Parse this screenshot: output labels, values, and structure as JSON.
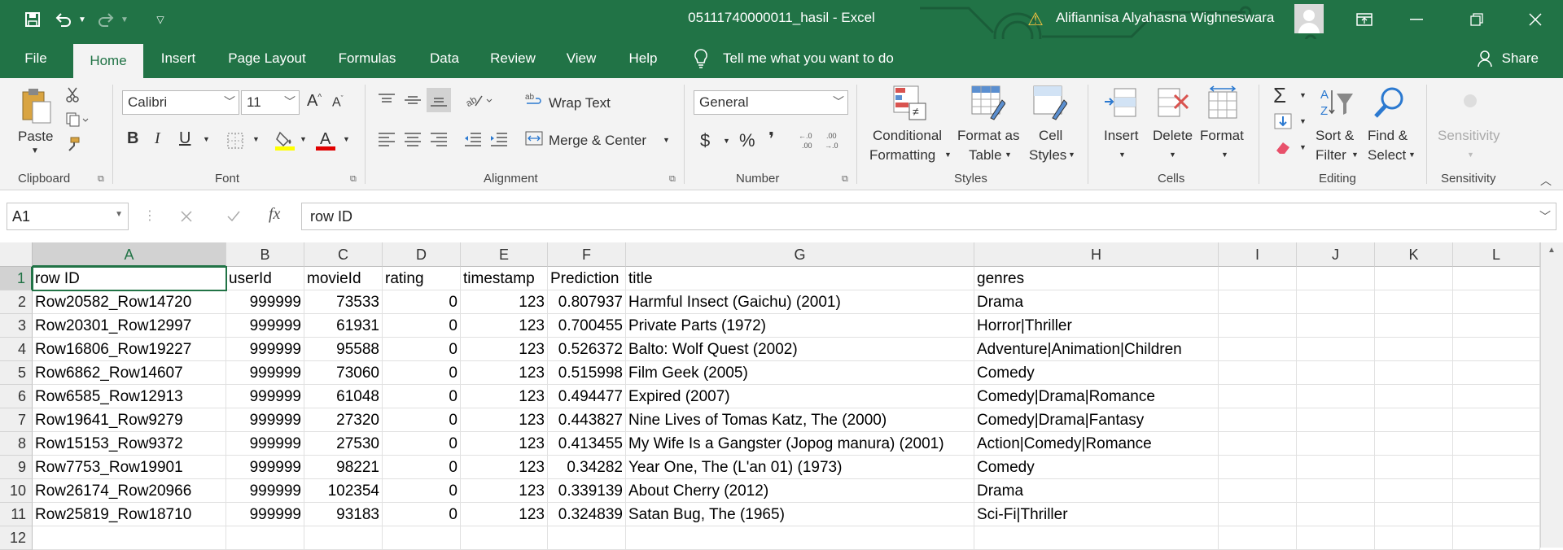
{
  "titlebar": {
    "doc_title": "05111740000011_hasil  -  Excel",
    "user_name": "Alifiannisa Alyahasna Wighneswara",
    "warning_symbol": "⚠"
  },
  "menu": {
    "items": [
      "File",
      "Home",
      "Insert",
      "Page Layout",
      "Formulas",
      "Data",
      "Review",
      "View",
      "Help"
    ],
    "tell_me": "Tell me what you want to do",
    "share": "Share"
  },
  "ribbon": {
    "clipboard": {
      "paste": "Paste",
      "label": "Clipboard"
    },
    "font": {
      "name": "Calibri",
      "size": "11",
      "bold": "B",
      "italic": "I",
      "underline": "U",
      "label": "Font"
    },
    "alignment": {
      "wrap": "Wrap Text",
      "merge": "Merge & Center",
      "label": "Alignment"
    },
    "number": {
      "format": "General",
      "currency": "$",
      "percent": "%",
      "comma": "❜",
      "label": "Number"
    },
    "styles": {
      "conditional_1": "Conditional",
      "conditional_2": "Formatting",
      "format_as_1": "Format as",
      "format_as_2": "Table",
      "cell_1": "Cell",
      "cell_2": "Styles",
      "label": "Styles"
    },
    "cells": {
      "insert": "Insert",
      "delete": "Delete",
      "format": "Format",
      "label": "Cells"
    },
    "editing": {
      "sum": "Σ",
      "sort_1": "Sort &",
      "sort_2": "Filter",
      "find_1": "Find &",
      "find_2": "Select",
      "label": "Editing"
    },
    "sensitivity": {
      "button": "Sensitivity",
      "label": "Sensitivity"
    }
  },
  "formula_bar": {
    "name_box": "A1",
    "fx": "fx",
    "value": "row ID"
  },
  "sheet": {
    "columns": [
      "A",
      "B",
      "C",
      "D",
      "E",
      "F",
      "G",
      "H",
      "I",
      "J",
      "K",
      "L"
    ],
    "row_numbers": [
      "1",
      "2",
      "3",
      "4",
      "5",
      "6",
      "7",
      "8",
      "9",
      "10",
      "11",
      "12"
    ],
    "header": [
      "row ID",
      "userId",
      "movieId",
      "rating",
      "timestamp",
      "Prediction",
      "title",
      "genres"
    ],
    "rows": [
      [
        "Row20582_Row14720",
        "999999",
        "73533",
        "0",
        "123",
        "0.807937",
        "Harmful Insect (Gaichu) (2001)",
        "Drama"
      ],
      [
        "Row20301_Row12997",
        "999999",
        "61931",
        "0",
        "123",
        "0.700455",
        "Private Parts (1972)",
        "Horror|Thriller"
      ],
      [
        "Row16806_Row19227",
        "999999",
        "95588",
        "0",
        "123",
        "0.526372",
        "Balto: Wolf Quest (2002)",
        "Adventure|Animation|Children"
      ],
      [
        "Row6862_Row14607",
        "999999",
        "73060",
        "0",
        "123",
        "0.515998",
        "Film Geek (2005)",
        "Comedy"
      ],
      [
        "Row6585_Row12913",
        "999999",
        "61048",
        "0",
        "123",
        "0.494477",
        "Expired (2007)",
        "Comedy|Drama|Romance"
      ],
      [
        "Row19641_Row9279",
        "999999",
        "27320",
        "0",
        "123",
        "0.443827",
        "Nine Lives of Tomas Katz, The (2000)",
        "Comedy|Drama|Fantasy"
      ],
      [
        "Row15153_Row9372",
        "999999",
        "27530",
        "0",
        "123",
        "0.413455",
        "My Wife Is a Gangster (Jopog manura) (2001)",
        "Action|Comedy|Romance"
      ],
      [
        "Row7753_Row19901",
        "999999",
        "98221",
        "0",
        "123",
        "0.34282",
        "Year One, The (L'an 01) (1973)",
        "Comedy"
      ],
      [
        "Row26174_Row20966",
        "999999",
        "102354",
        "0",
        "123",
        "0.339139",
        "About Cherry (2012)",
        "Drama"
      ],
      [
        "Row25819_Row18710",
        "999999",
        "93183",
        "0",
        "123",
        "0.324839",
        "Satan Bug, The (1965)",
        "Sci-Fi|Thriller"
      ]
    ]
  },
  "colors": {
    "excel_green": "#217346",
    "ribbon_bg": "#f3f3f3"
  }
}
